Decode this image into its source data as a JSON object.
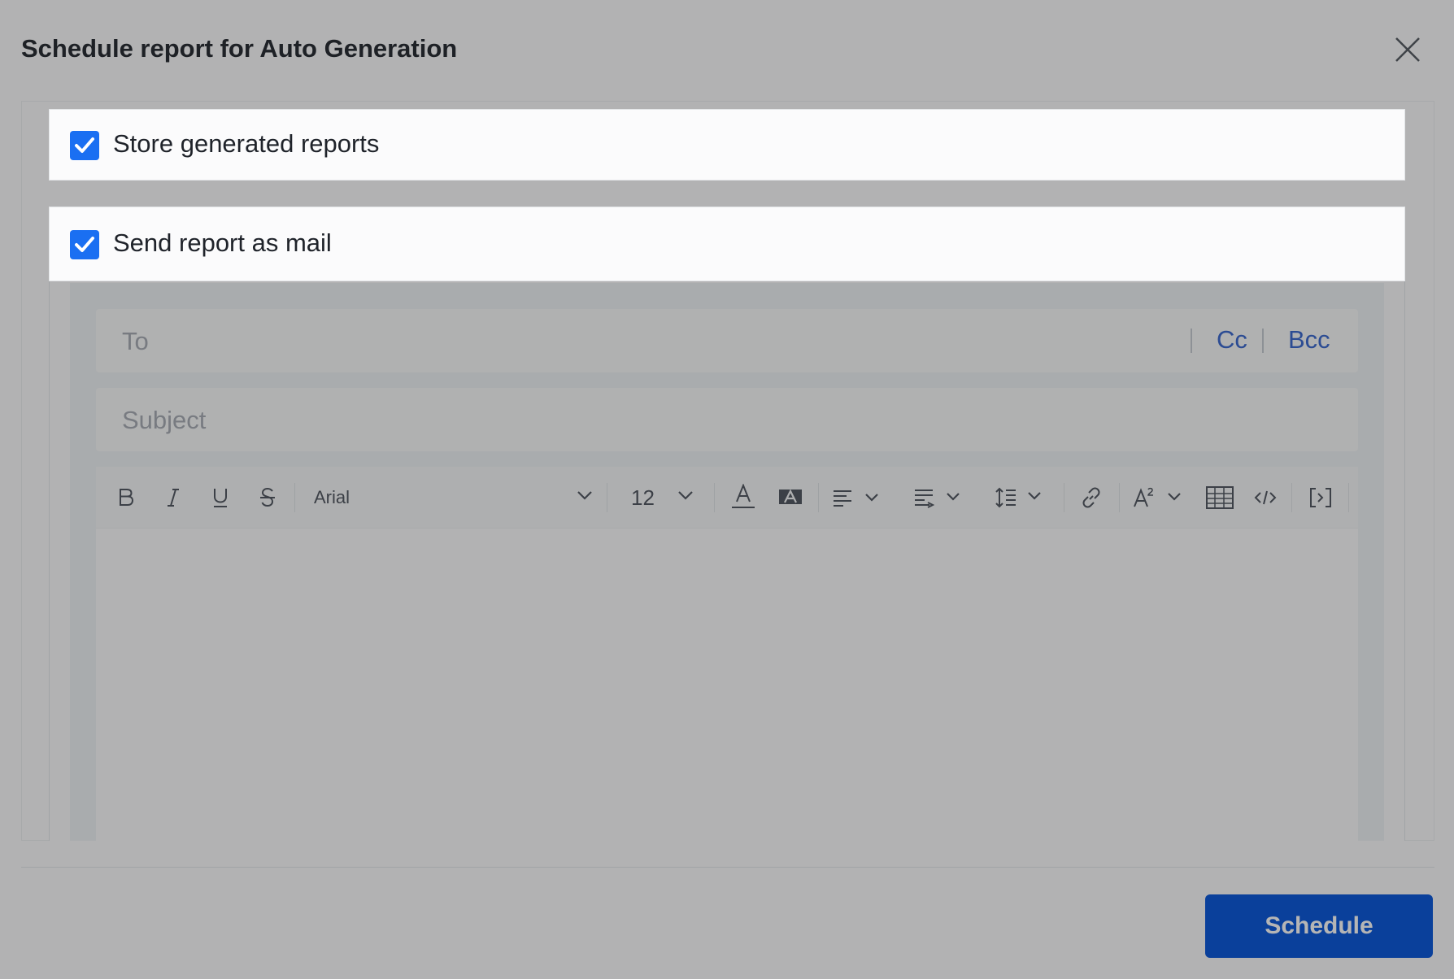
{
  "dialog": {
    "title": "Schedule report for Auto Generation",
    "close_icon": "close-icon"
  },
  "options": {
    "store": {
      "label": "Store generated reports",
      "checked": true
    },
    "mail": {
      "label": "Send report as mail",
      "checked": true
    }
  },
  "mail": {
    "to_placeholder": "To",
    "cc_label": "Cc",
    "bcc_label": "Bcc",
    "subject_placeholder": "Subject"
  },
  "toolbar": {
    "font_family": "Arial",
    "font_size": "12",
    "icons": [
      "bold-icon",
      "italic-icon",
      "underline-icon",
      "strikethrough-icon",
      "font-color-icon",
      "highlight-icon",
      "align-icon",
      "indent-icon",
      "line-height-icon",
      "link-icon",
      "superscript-icon",
      "table-icon",
      "code-icon",
      "merge-field-icon"
    ]
  },
  "footer": {
    "schedule_label": "Schedule"
  },
  "colors": {
    "accent": "#1a6ff2",
    "button": "#0f5bdb",
    "link": "#3e6ccf",
    "overlay": "rgba(0,0,0,0.29)"
  }
}
